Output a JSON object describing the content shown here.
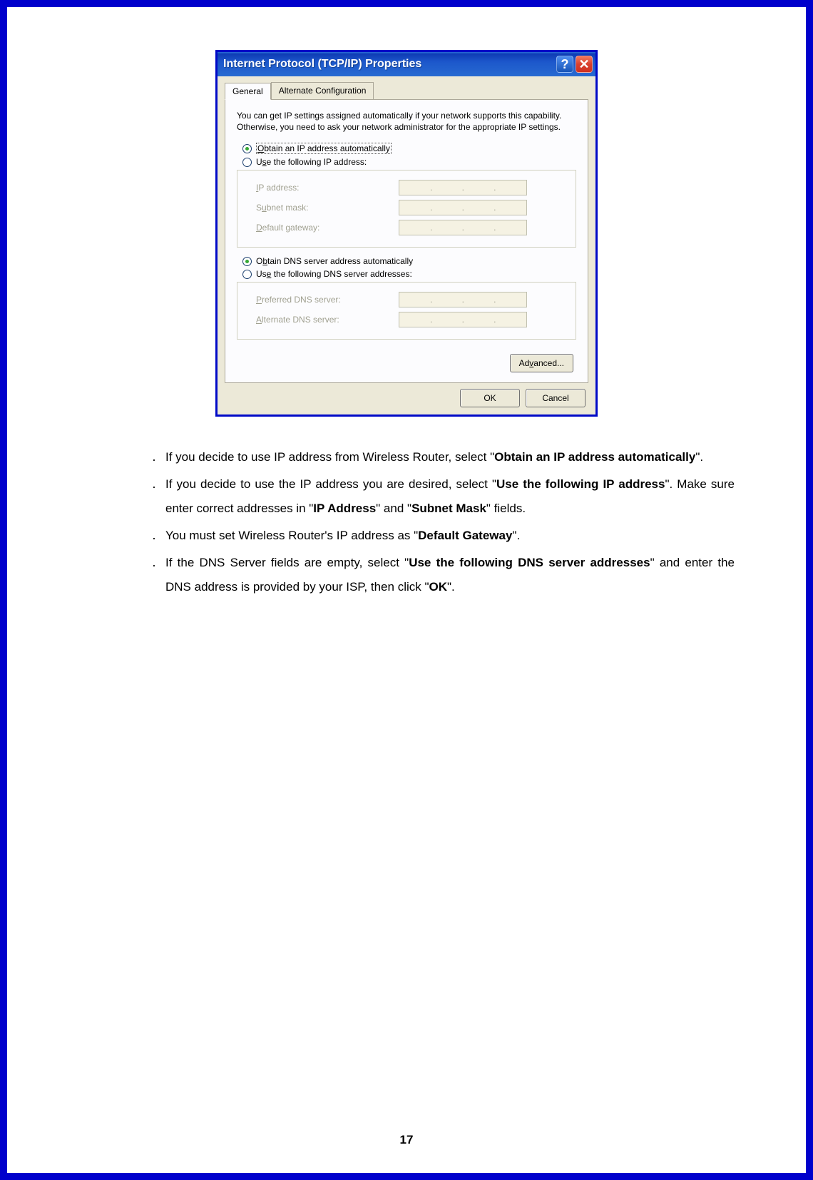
{
  "dialog": {
    "title": "Internet Protocol (TCP/IP) Properties",
    "tabs": {
      "general": "General",
      "alternate": "Alternate Configuration"
    },
    "description": "You can get IP settings assigned automatically if your network supports this capability. Otherwise, you need to ask your network administrator for the appropriate IP settings.",
    "radio_ip_auto_prefix": "O",
    "radio_ip_auto_rest": "btain an IP address automatically",
    "radio_ip_manual": "Use the following IP address:",
    "radio_ip_manual_u": "s",
    "fields": {
      "ip_label_prefix": "I",
      "ip_label_rest": "P address:",
      "subnet_label": "Subnet mask:",
      "subnet_u": "u",
      "gateway_label": "Default gateway:",
      "gateway_u": "D"
    },
    "radio_dns_auto": "Obtain DNS server address automatically",
    "radio_dns_auto_u": "b",
    "radio_dns_manual": "Use the following DNS server addresses:",
    "radio_dns_manual_u": "e",
    "dns_fields": {
      "preferred": "Preferred DNS server:",
      "preferred_u": "P",
      "alternate": "Alternate DNS server:",
      "alternate_u": "A"
    },
    "advanced": "Advanced...",
    "advanced_u": "v",
    "ok": "OK",
    "cancel": "Cancel"
  },
  "bullets": {
    "b1_a": "If you decide to use IP address from Wireless Router, select \"",
    "b1_bold": "Obtain an IP address automatically",
    "b1_b": "\".",
    "b2_a": "If you decide to use the IP address you are desired, select \"",
    "b2_bold1": "Use the following IP address",
    "b2_b": "\".    Make sure enter correct addresses in \"",
    "b2_bold2": "IP Address",
    "b2_c": "\" and \"",
    "b2_bold3": "Subnet Mask",
    "b2_d": "\" fields.",
    "b3_a": "You must set Wireless Router's IP address as \"",
    "b3_bold": "Default Gateway",
    "b3_b": "\".",
    "b4_a": "If the DNS Server fields are empty, select \"",
    "b4_bold": "Use the following DNS server addresses",
    "b4_b": "\" and enter the DNS address is provided by your ISP, then click \"",
    "b4_bold2": "OK",
    "b4_c": "\"."
  },
  "page_number": "17",
  "dot": "․"
}
